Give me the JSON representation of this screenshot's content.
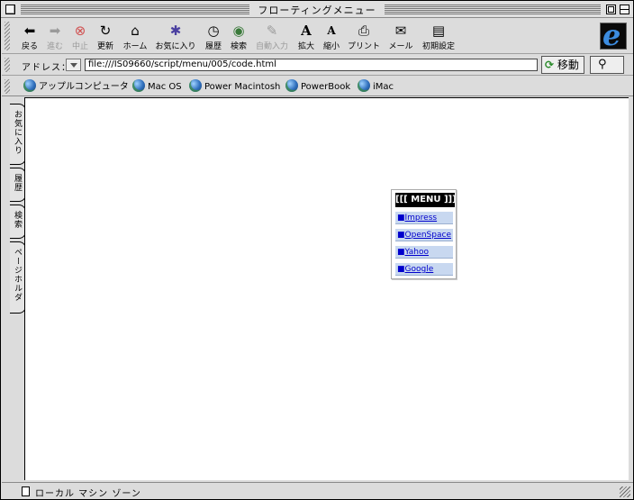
{
  "window": {
    "title": "フローティングメニュー"
  },
  "toolbar": {
    "buttons": [
      {
        "label": "戻る",
        "icon": "back-arrow-icon",
        "glyph": "⬅"
      },
      {
        "label": "進む",
        "icon": "forward-arrow-icon",
        "glyph": "➡"
      },
      {
        "label": "中止",
        "icon": "stop-icon",
        "glyph": "⊗"
      },
      {
        "label": "更新",
        "icon": "refresh-icon",
        "glyph": "↻"
      },
      {
        "label": "ホーム",
        "icon": "home-icon",
        "glyph": "⌂"
      },
      {
        "label": "お気に入り",
        "icon": "favorites-icon",
        "glyph": "✱"
      },
      {
        "label": "履歴",
        "icon": "history-clock-icon",
        "glyph": "◷"
      },
      {
        "label": "検索",
        "icon": "search-magnifier-icon",
        "glyph": "◉"
      },
      {
        "label": "自動入力",
        "icon": "autofill-icon",
        "glyph": "✎"
      },
      {
        "label": "拡大",
        "icon": "enlarge-text-icon",
        "glyph": "A"
      },
      {
        "label": "縮小",
        "icon": "shrink-text-icon",
        "glyph": "A"
      },
      {
        "label": "プリント",
        "icon": "printer-icon",
        "glyph": "⎙"
      },
      {
        "label": "メール",
        "icon": "mail-icon",
        "glyph": "✉"
      },
      {
        "label": "初期設定",
        "icon": "preferences-icon",
        "glyph": "▤"
      }
    ],
    "ie_logo_glyph": "e"
  },
  "address": {
    "label": "アドレス：",
    "url": "file:///IS09660/script/menu/005/code.html",
    "go_label": "移動",
    "go_glyph": "⟳",
    "search_glyph": "⚲"
  },
  "favorites": {
    "items": [
      {
        "label": "アップルコンピュータ"
      },
      {
        "label": "Mac OS"
      },
      {
        "label": "Power Macintosh"
      },
      {
        "label": "PowerBook"
      },
      {
        "label": "iMac"
      }
    ]
  },
  "sidetabs": [
    {
      "label": "お気に入り"
    },
    {
      "label": "履歴"
    },
    {
      "label": "検索"
    },
    {
      "label": "ページホルダ"
    }
  ],
  "float_menu": {
    "title": "[[[ MENU ]]]",
    "bullet": "■",
    "items": [
      {
        "label": "Impress"
      },
      {
        "label": "OpenSpace"
      },
      {
        "label": "Yahoo"
      },
      {
        "label": "Google"
      }
    ]
  },
  "status": {
    "text": "ローカル マシン ゾーン"
  },
  "colors": {
    "menu_item_bg": "#c8d8f0",
    "link": "#0000cc",
    "chrome": "#dcdcdc"
  }
}
